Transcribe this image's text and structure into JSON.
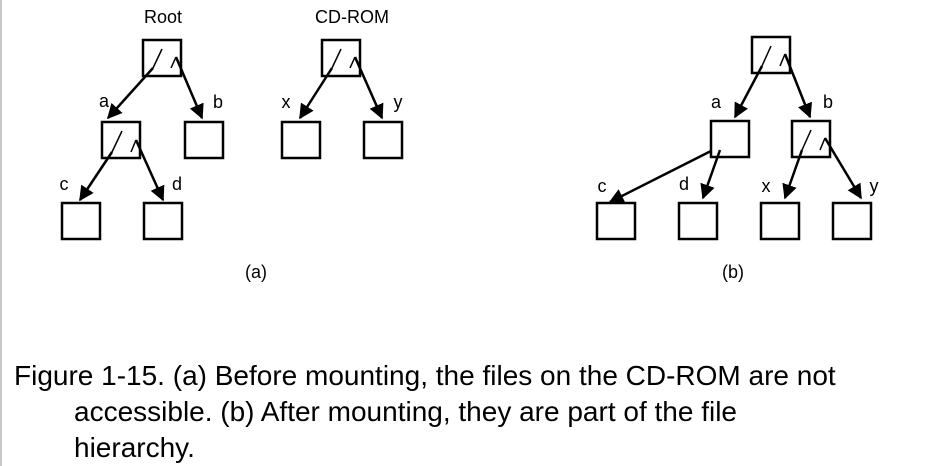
{
  "panel_a": {
    "root_title": "Root",
    "cdrom_title": "CD-ROM",
    "label": "(a)",
    "edges": {
      "a": "a",
      "b": "b",
      "c": "c",
      "d": "d",
      "x": "x",
      "y": "y"
    }
  },
  "panel_b": {
    "label": "(b)",
    "edges": {
      "a": "a",
      "b": "b",
      "c": "c",
      "d": "d",
      "x": "x",
      "y": "y"
    }
  },
  "caption": {
    "line1": "Figure 1-15. (a) Before mounting, the files on the CD-ROM are not",
    "line2": "accessible.  (b) After mounting, they are part of the file",
    "line3": "hierarchy."
  }
}
